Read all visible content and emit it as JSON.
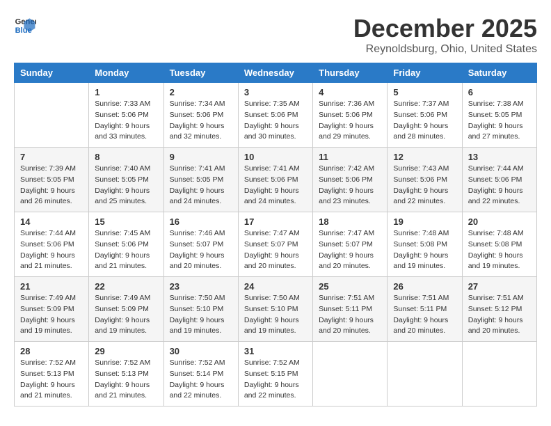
{
  "header": {
    "logo_line1": "General",
    "logo_line2": "Blue",
    "month": "December 2025",
    "location": "Reynoldsburg, Ohio, United States"
  },
  "days_of_week": [
    "Sunday",
    "Monday",
    "Tuesday",
    "Wednesday",
    "Thursday",
    "Friday",
    "Saturday"
  ],
  "weeks": [
    [
      {
        "day": "",
        "info": ""
      },
      {
        "day": "1",
        "info": "Sunrise: 7:33 AM\nSunset: 5:06 PM\nDaylight: 9 hours\nand 33 minutes."
      },
      {
        "day": "2",
        "info": "Sunrise: 7:34 AM\nSunset: 5:06 PM\nDaylight: 9 hours\nand 32 minutes."
      },
      {
        "day": "3",
        "info": "Sunrise: 7:35 AM\nSunset: 5:06 PM\nDaylight: 9 hours\nand 30 minutes."
      },
      {
        "day": "4",
        "info": "Sunrise: 7:36 AM\nSunset: 5:06 PM\nDaylight: 9 hours\nand 29 minutes."
      },
      {
        "day": "5",
        "info": "Sunrise: 7:37 AM\nSunset: 5:06 PM\nDaylight: 9 hours\nand 28 minutes."
      },
      {
        "day": "6",
        "info": "Sunrise: 7:38 AM\nSunset: 5:05 PM\nDaylight: 9 hours\nand 27 minutes."
      }
    ],
    [
      {
        "day": "7",
        "info": "Sunrise: 7:39 AM\nSunset: 5:05 PM\nDaylight: 9 hours\nand 26 minutes."
      },
      {
        "day": "8",
        "info": "Sunrise: 7:40 AM\nSunset: 5:05 PM\nDaylight: 9 hours\nand 25 minutes."
      },
      {
        "day": "9",
        "info": "Sunrise: 7:41 AM\nSunset: 5:05 PM\nDaylight: 9 hours\nand 24 minutes."
      },
      {
        "day": "10",
        "info": "Sunrise: 7:41 AM\nSunset: 5:06 PM\nDaylight: 9 hours\nand 24 minutes."
      },
      {
        "day": "11",
        "info": "Sunrise: 7:42 AM\nSunset: 5:06 PM\nDaylight: 9 hours\nand 23 minutes."
      },
      {
        "day": "12",
        "info": "Sunrise: 7:43 AM\nSunset: 5:06 PM\nDaylight: 9 hours\nand 22 minutes."
      },
      {
        "day": "13",
        "info": "Sunrise: 7:44 AM\nSunset: 5:06 PM\nDaylight: 9 hours\nand 22 minutes."
      }
    ],
    [
      {
        "day": "14",
        "info": "Sunrise: 7:44 AM\nSunset: 5:06 PM\nDaylight: 9 hours\nand 21 minutes."
      },
      {
        "day": "15",
        "info": "Sunrise: 7:45 AM\nSunset: 5:06 PM\nDaylight: 9 hours\nand 21 minutes."
      },
      {
        "day": "16",
        "info": "Sunrise: 7:46 AM\nSunset: 5:07 PM\nDaylight: 9 hours\nand 20 minutes."
      },
      {
        "day": "17",
        "info": "Sunrise: 7:47 AM\nSunset: 5:07 PM\nDaylight: 9 hours\nand 20 minutes."
      },
      {
        "day": "18",
        "info": "Sunrise: 7:47 AM\nSunset: 5:07 PM\nDaylight: 9 hours\nand 20 minutes."
      },
      {
        "day": "19",
        "info": "Sunrise: 7:48 AM\nSunset: 5:08 PM\nDaylight: 9 hours\nand 19 minutes."
      },
      {
        "day": "20",
        "info": "Sunrise: 7:48 AM\nSunset: 5:08 PM\nDaylight: 9 hours\nand 19 minutes."
      }
    ],
    [
      {
        "day": "21",
        "info": "Sunrise: 7:49 AM\nSunset: 5:09 PM\nDaylight: 9 hours\nand 19 minutes."
      },
      {
        "day": "22",
        "info": "Sunrise: 7:49 AM\nSunset: 5:09 PM\nDaylight: 9 hours\nand 19 minutes."
      },
      {
        "day": "23",
        "info": "Sunrise: 7:50 AM\nSunset: 5:10 PM\nDaylight: 9 hours\nand 19 minutes."
      },
      {
        "day": "24",
        "info": "Sunrise: 7:50 AM\nSunset: 5:10 PM\nDaylight: 9 hours\nand 19 minutes."
      },
      {
        "day": "25",
        "info": "Sunrise: 7:51 AM\nSunset: 5:11 PM\nDaylight: 9 hours\nand 20 minutes."
      },
      {
        "day": "26",
        "info": "Sunrise: 7:51 AM\nSunset: 5:11 PM\nDaylight: 9 hours\nand 20 minutes."
      },
      {
        "day": "27",
        "info": "Sunrise: 7:51 AM\nSunset: 5:12 PM\nDaylight: 9 hours\nand 20 minutes."
      }
    ],
    [
      {
        "day": "28",
        "info": "Sunrise: 7:52 AM\nSunset: 5:13 PM\nDaylight: 9 hours\nand 21 minutes."
      },
      {
        "day": "29",
        "info": "Sunrise: 7:52 AM\nSunset: 5:13 PM\nDaylight: 9 hours\nand 21 minutes."
      },
      {
        "day": "30",
        "info": "Sunrise: 7:52 AM\nSunset: 5:14 PM\nDaylight: 9 hours\nand 22 minutes."
      },
      {
        "day": "31",
        "info": "Sunrise: 7:52 AM\nSunset: 5:15 PM\nDaylight: 9 hours\nand 22 minutes."
      },
      {
        "day": "",
        "info": ""
      },
      {
        "day": "",
        "info": ""
      },
      {
        "day": "",
        "info": ""
      }
    ]
  ]
}
